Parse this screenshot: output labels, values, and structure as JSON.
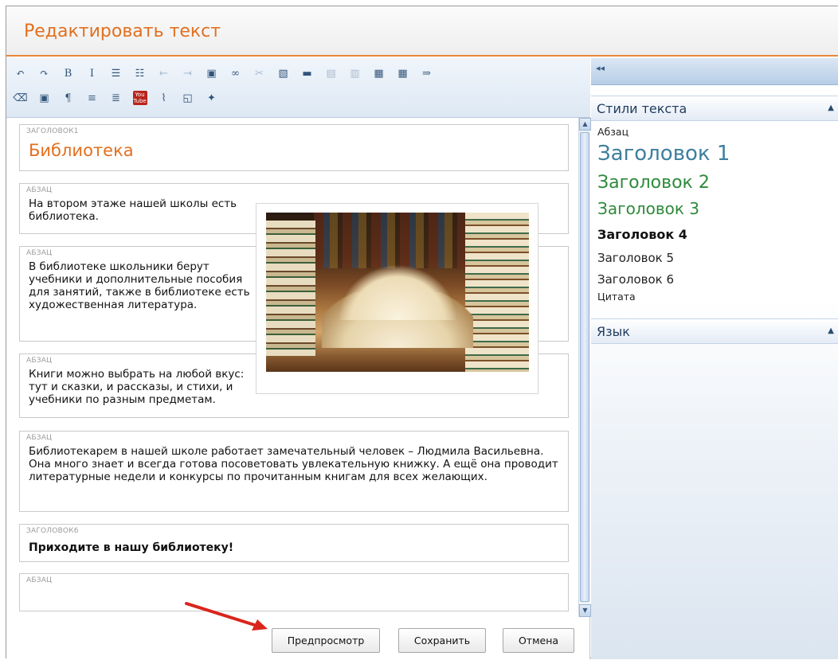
{
  "window": {
    "title": "Редактировать текст"
  },
  "toolbar": {
    "row1": [
      {
        "name": "undo-icon",
        "glyph": "↶",
        "dim": false
      },
      {
        "name": "redo-icon",
        "glyph": "↷",
        "dim": false
      },
      {
        "name": "bold-icon",
        "glyph": "B",
        "dim": false
      },
      {
        "name": "italic-icon",
        "glyph": "I",
        "dim": false
      },
      {
        "name": "numbered-list-icon",
        "glyph": "☰",
        "dim": false
      },
      {
        "name": "bullet-list-icon",
        "glyph": "☷",
        "dim": false
      },
      {
        "name": "outdent-icon",
        "glyph": "⇤",
        "dim": true
      },
      {
        "name": "indent-icon",
        "glyph": "⇥",
        "dim": true
      },
      {
        "name": "paste-icon",
        "glyph": "▣",
        "dim": false
      },
      {
        "name": "link-icon",
        "glyph": "∞",
        "dim": false
      },
      {
        "name": "unlink-icon",
        "glyph": "✂",
        "dim": true
      },
      {
        "name": "image-icon",
        "glyph": "▧",
        "dim": false
      },
      {
        "name": "media-icon",
        "glyph": "▬",
        "dim": false
      },
      {
        "name": "column-left-icon",
        "glyph": "▤",
        "dim": true
      },
      {
        "name": "column-right-icon",
        "glyph": "▥",
        "dim": true
      },
      {
        "name": "layout-icon",
        "glyph": "▦",
        "dim": false
      },
      {
        "name": "table-icon",
        "glyph": "▦",
        "dim": false
      },
      {
        "name": "wrap-icon",
        "glyph": "⇒",
        "dim": false
      }
    ],
    "row2": [
      {
        "name": "eraser-icon",
        "glyph": "⌫",
        "dim": false
      },
      {
        "name": "widget-icon",
        "glyph": "▣",
        "dim": false
      },
      {
        "name": "paragraph-icon",
        "glyph": "¶",
        "dim": false
      },
      {
        "name": "horizontal-rule-icon",
        "glyph": "≡",
        "dim": false
      },
      {
        "name": "align-icon",
        "glyph": "≣",
        "dim": false
      },
      {
        "name": "youtube-icon",
        "glyph": "You Tube",
        "dim": false
      },
      {
        "name": "attachment-icon",
        "glyph": "⌇",
        "dim": false
      },
      {
        "name": "insert-page-icon",
        "glyph": "◱",
        "dim": false
      },
      {
        "name": "puzzle-icon",
        "glyph": "✦",
        "dim": false
      }
    ]
  },
  "blocks": [
    {
      "label": "ЗАГОЛОВОК1",
      "text": "Библиотека"
    },
    {
      "label": "АБЗАЦ",
      "text": "На втором этаже нашей школы есть библиотека."
    },
    {
      "label": "АБЗАЦ",
      "text": "В библиотеке школьники берут учебники и дополнительные пособия для занятий, также в библиотеке есть художественная литература."
    },
    {
      "label": "АБЗАЦ",
      "text": "Книги можно выбрать на любой вкус: тут и сказки, и рассказы, и стихи, и учебники по разным предметам."
    },
    {
      "label": "АБЗАЦ",
      "text": "Библиотекарем в нашей школе работает замечательный человек – Людмила Васильевна. Она много знает и всегда готова посоветовать увлекательную книжку. А ещё она проводит литературные недели и конкурсы по прочитанным книгам для всех желающих."
    },
    {
      "label": "ЗАГОЛОВОК6",
      "text": "Приходите в нашу библиотеку!"
    },
    {
      "label": "АБЗАЦ",
      "text": ""
    }
  ],
  "buttons": {
    "preview": "Предпросмотр",
    "save": "Сохранить",
    "cancel": "Отмена"
  },
  "panel": {
    "collapse": "◂◂",
    "styles_title": "Стили текста",
    "styles_toggle": "▲",
    "styles": {
      "paragraph": "Абзац",
      "h1": "Заголовок 1",
      "h2": "Заголовок 2",
      "h3": "Заголовок 3",
      "h4": "Заголовок 4",
      "h5": "Заголовок 5",
      "h6": "Заголовок 6",
      "quote": "Цитата"
    },
    "language_title": "Язык",
    "language_toggle": "▲"
  },
  "colors": {
    "accent": "#e2701f",
    "h1": "#3e7f9e",
    "h2": "#2e8a3a",
    "panel_blue": "#b7cde6"
  }
}
